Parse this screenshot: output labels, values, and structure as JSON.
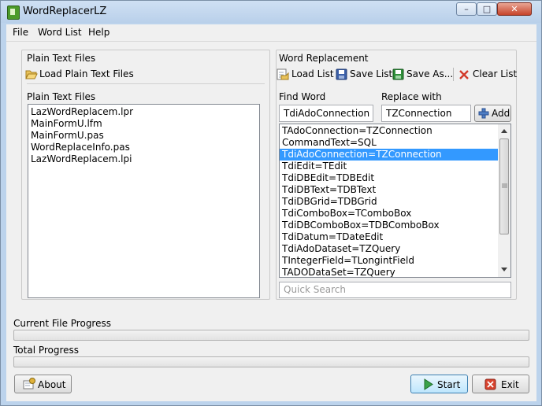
{
  "window": {
    "title": "WordReplacerLZ",
    "buttons": {
      "minimize": "–",
      "maximize": "□",
      "close": "✕"
    }
  },
  "menu": [
    "File",
    "Word List",
    "Help"
  ],
  "left_group": {
    "title": "Plain Text Files",
    "load_button": "Load Plain Text Files",
    "list_label": "Plain Text Files",
    "files": [
      "LazWordReplacem.lpr",
      "MainFormU.lfm",
      "MainFormU.pas",
      "WordReplaceInfo.pas",
      "LazWordReplacem.lpi"
    ]
  },
  "right_group": {
    "title": "Word Replacement",
    "toolbar": {
      "load_list": "Load List",
      "save_list": "Save List",
      "save_as": "Save As...",
      "clear_list": "Clear List"
    },
    "find_label": "Find Word",
    "find_value": "TdiAdoConnection",
    "replace_label": "Replace with",
    "replace_value": "TZConnection",
    "add_button": "Add",
    "replacements": [
      "TAdoConnection=TZConnection",
      "CommandText=SQL",
      "TdiAdoConnection=TZConnection",
      "TdiEdit=TEdit",
      "TdiDBEdit=TDBEdit",
      "TdiDBText=TDBText",
      "TdiDBGrid=TDBGrid",
      "TdiComboBox=TComboBox",
      "TdiDBComboBox=TDBComboBox",
      "TdiDatum=TDateEdit",
      "TdiAdoDataset=TZQuery",
      "TIntegerField=TLongintField",
      "TADODataSet=TZQuery"
    ],
    "selected_index": 2,
    "search_placeholder": "Quick Search"
  },
  "progress": {
    "current_label": "Current File Progress",
    "current_value": 0,
    "total_label": "Total Progress",
    "total_value": 0
  },
  "buttons": {
    "about": "About",
    "start": "Start",
    "exit": "Exit"
  }
}
